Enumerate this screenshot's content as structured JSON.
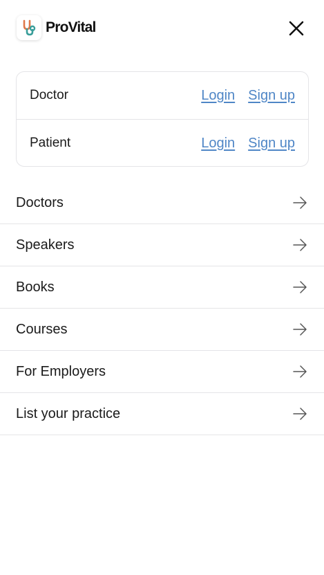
{
  "brand": {
    "name": "ProVital",
    "logo_icon": "stethoscope-icon"
  },
  "header": {
    "close_icon": "close-icon"
  },
  "auth": {
    "rows": [
      {
        "role": "Doctor",
        "login": "Login",
        "signup": "Sign up"
      },
      {
        "role": "Patient",
        "login": "Login",
        "signup": "Sign up"
      }
    ],
    "link_color": "#4f86c6"
  },
  "nav": {
    "items": [
      {
        "label": "Doctors"
      },
      {
        "label": "Speakers"
      },
      {
        "label": "Books"
      },
      {
        "label": "Courses"
      },
      {
        "label": "For Employers"
      },
      {
        "label": "List your practice"
      }
    ],
    "arrow_icon": "arrow-right-icon"
  }
}
